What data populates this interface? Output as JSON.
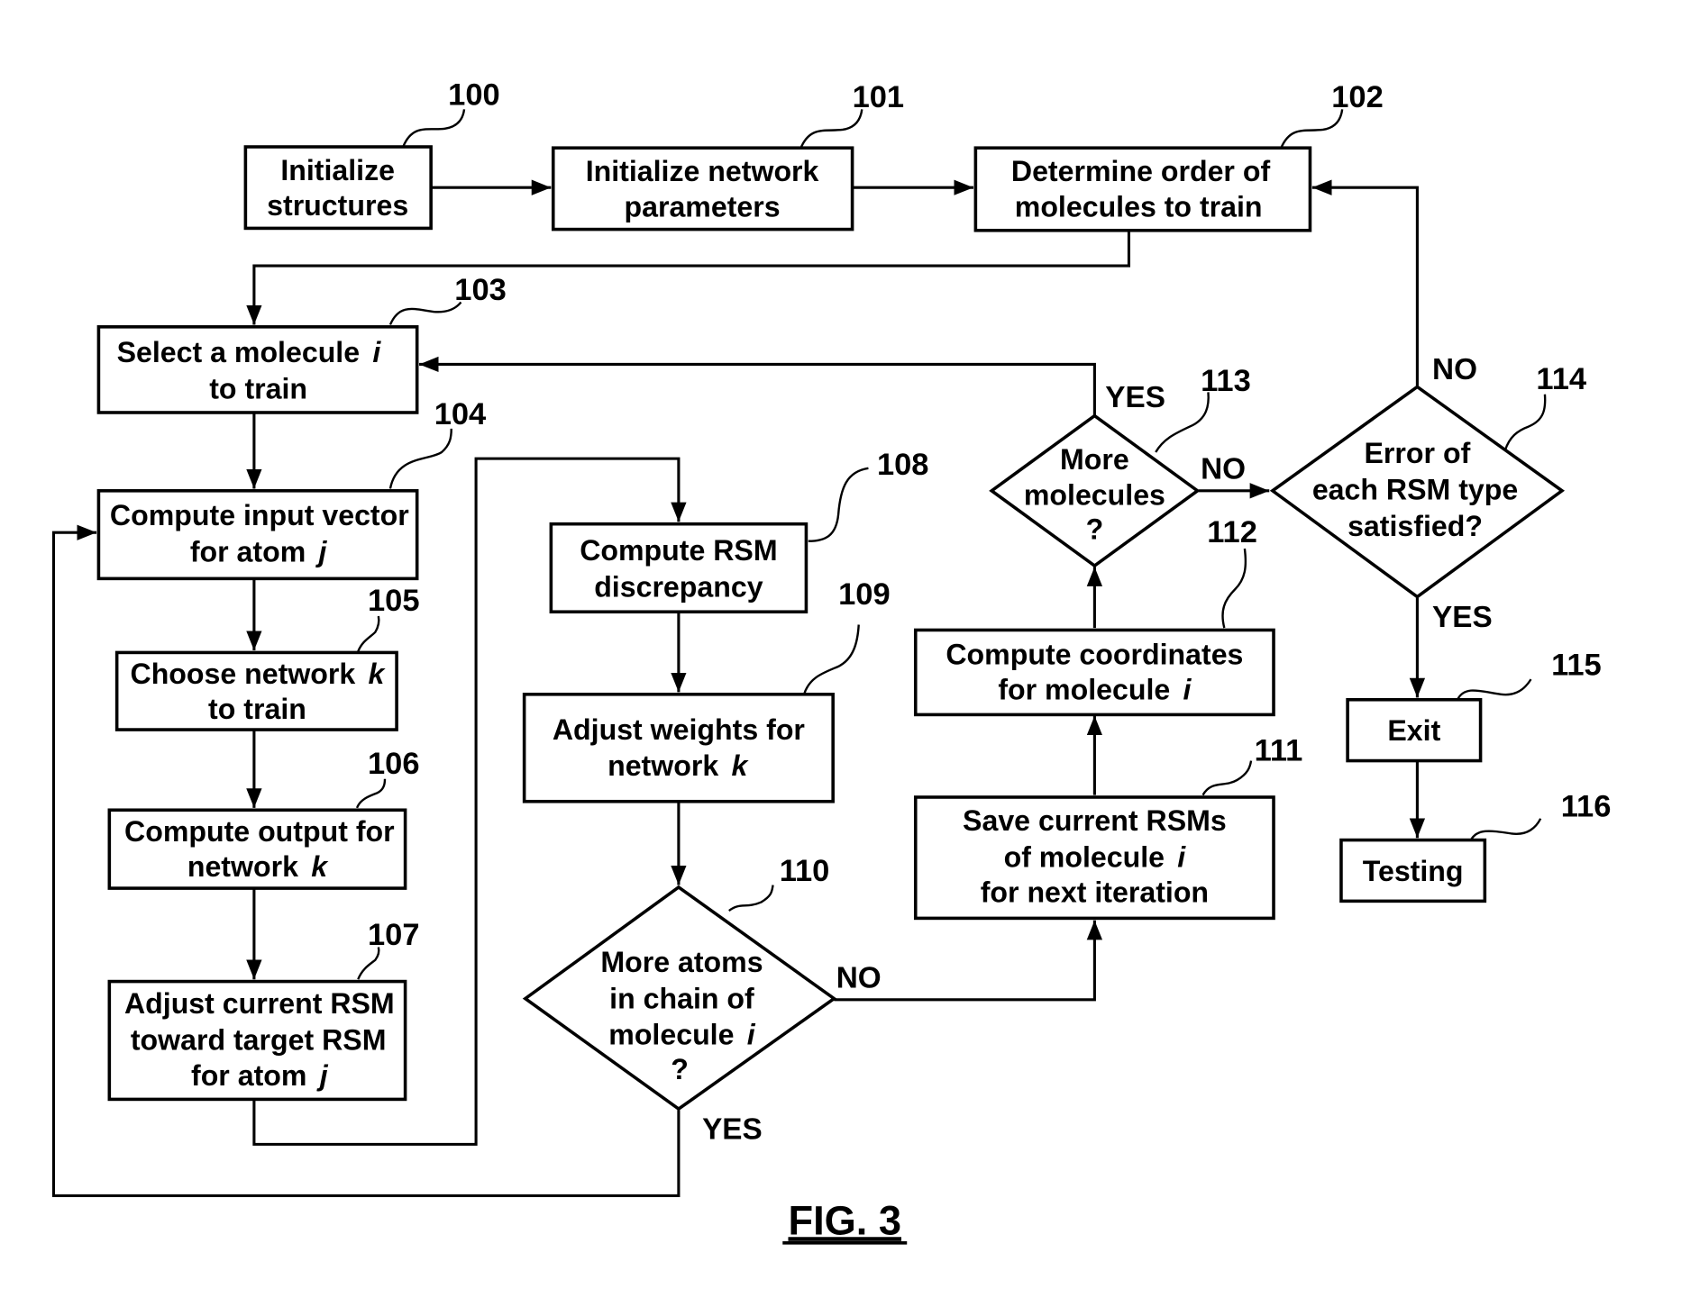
{
  "figure": {
    "caption": "FIG. 3"
  },
  "nodes": {
    "n100": {
      "ref": "100",
      "lines": [
        "Initialize",
        "structures"
      ]
    },
    "n101": {
      "ref": "101",
      "lines": [
        "Initialize network",
        "parameters"
      ]
    },
    "n102": {
      "ref": "102",
      "lines": [
        "Determine order of",
        "molecules to train"
      ]
    },
    "n103": {
      "ref": "103",
      "lines": [
        "Select a molecule",
        "to train"
      ],
      "var": "i"
    },
    "n104": {
      "ref": "104",
      "lines": [
        "Compute input vector",
        "for atom"
      ],
      "var": "j"
    },
    "n105": {
      "ref": "105",
      "lines": [
        "Choose network",
        "to train"
      ],
      "var": "k"
    },
    "n106": {
      "ref": "106",
      "lines": [
        "Compute output for",
        "network"
      ],
      "var": "k"
    },
    "n107": {
      "ref": "107",
      "lines": [
        "Adjust current RSM",
        "toward target RSM",
        "for atom"
      ],
      "var": "j"
    },
    "n108": {
      "ref": "108",
      "lines": [
        "Compute RSM",
        "discrepancy"
      ]
    },
    "n109": {
      "ref": "109",
      "lines": [
        "Adjust weights for",
        "network"
      ],
      "var": "k"
    },
    "n110": {
      "ref": "110",
      "lines": [
        "More atoms",
        "in  chain of",
        "molecule",
        "?"
      ],
      "var": "i"
    },
    "n111": {
      "ref": "111",
      "lines": [
        "Save current RSMs",
        "of molecule",
        "for next iteration"
      ],
      "var": "i"
    },
    "n112": {
      "ref": "112",
      "lines": [
        "Compute coordinates",
        "for molecule"
      ],
      "var": "i"
    },
    "n113": {
      "ref": "113",
      "lines": [
        "More",
        "molecules",
        "?"
      ]
    },
    "n114": {
      "ref": "114",
      "lines": [
        "Error of",
        "each RSM type",
        "satisfied?"
      ]
    },
    "n115": {
      "ref": "115",
      "lines": [
        "Exit"
      ]
    },
    "n116": {
      "ref": "116",
      "lines": [
        "Testing"
      ]
    }
  },
  "branch_labels": {
    "b113_yes": "YES",
    "b113_no": "NO",
    "b114_no": "NO",
    "b114_yes": "YES",
    "b110_no": "NO",
    "b110_yes": "YES"
  }
}
